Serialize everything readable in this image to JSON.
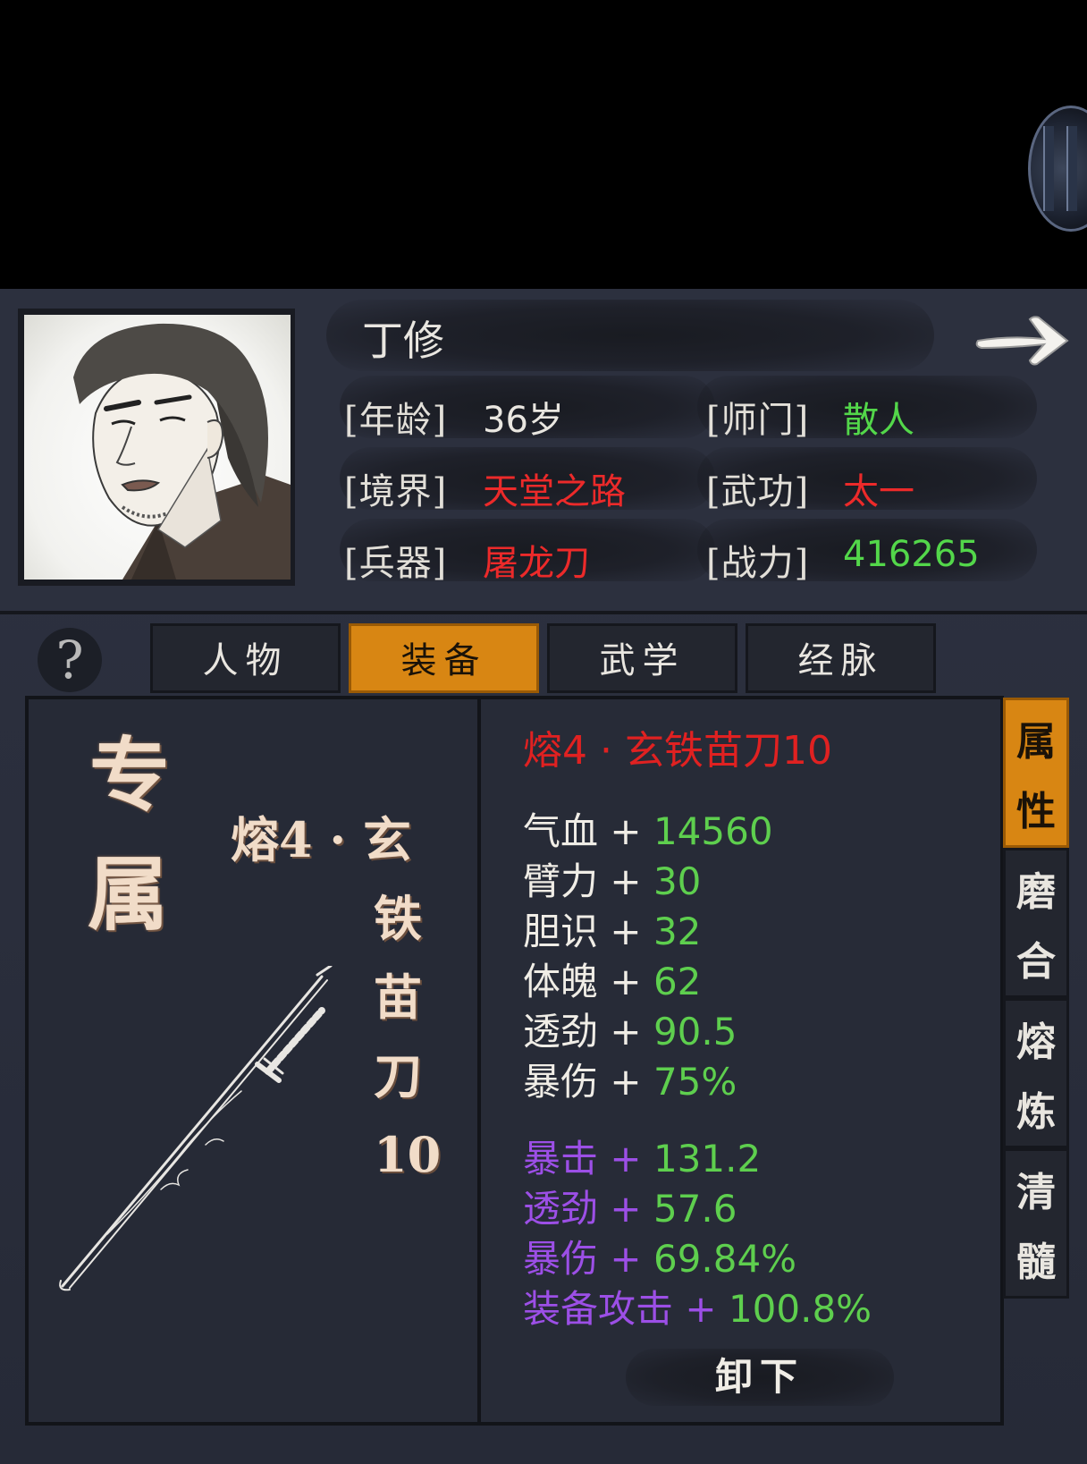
{
  "character": {
    "name": "丁修",
    "attributes": [
      {
        "label": "[年龄]",
        "value": "36岁",
        "color": "#e9e6e0"
      },
      {
        "label": "[师门]",
        "value": "散人",
        "color": "#53d74a"
      },
      {
        "label": "[境界]",
        "value": "天堂之路",
        "color": "#ec2a2a"
      },
      {
        "label": "[武功]",
        "value": "太一",
        "color": "#ec2a2a"
      },
      {
        "label": "[兵器]",
        "value": "屠龙刀",
        "color": "#ec2a2a"
      },
      {
        "label": "[战力]",
        "value": "416265",
        "color": "#53d74a"
      }
    ]
  },
  "icons": {
    "help": "?",
    "next": "arrow-right-icon"
  },
  "tabs": [
    {
      "label": "人物",
      "active": false
    },
    {
      "label": "装备",
      "active": true
    },
    {
      "label": "武学",
      "active": false
    },
    {
      "label": "经脉",
      "active": false
    }
  ],
  "equipment": {
    "exclusive_chars": [
      "专",
      "属"
    ],
    "vertical_name_prefix": "熔4 · 玄",
    "vertical_name_chars": [
      "铁",
      "苗",
      "刀",
      "10"
    ],
    "title": "熔4 · 玄铁苗刀10",
    "base_stats": [
      {
        "name": "气血",
        "plus": "+",
        "value": "14560"
      },
      {
        "name": "臂力",
        "plus": "+",
        "value": "30"
      },
      {
        "name": "胆识",
        "plus": "+",
        "value": "32"
      },
      {
        "name": "体魄",
        "plus": "+",
        "value": "62"
      },
      {
        "name": "透劲",
        "plus": "+",
        "value": "90.5"
      },
      {
        "name": "暴伤",
        "plus": "+",
        "value": "75%"
      }
    ],
    "bonus_stats": [
      {
        "name": "暴击",
        "plus": "+",
        "value": "131.2"
      },
      {
        "name": "透劲",
        "plus": "+",
        "value": "57.6"
      },
      {
        "name": "暴伤",
        "plus": "+",
        "value": "69.84%"
      },
      {
        "name": "装备攻击",
        "plus": "+",
        "value": "100.8%"
      }
    ],
    "unequip_label": "卸下"
  },
  "side_tabs": [
    {
      "chars": [
        "属",
        "性"
      ],
      "active": true
    },
    {
      "chars": [
        "磨",
        "合"
      ],
      "active": false
    },
    {
      "chars": [
        "熔",
        "炼"
      ],
      "active": false
    },
    {
      "chars": [
        "清",
        "髓"
      ],
      "active": false
    }
  ],
  "colors": {
    "accent": "#d88613",
    "red": "#e02121",
    "green": "#5ecf4e",
    "purple": "#9c4fe6"
  }
}
